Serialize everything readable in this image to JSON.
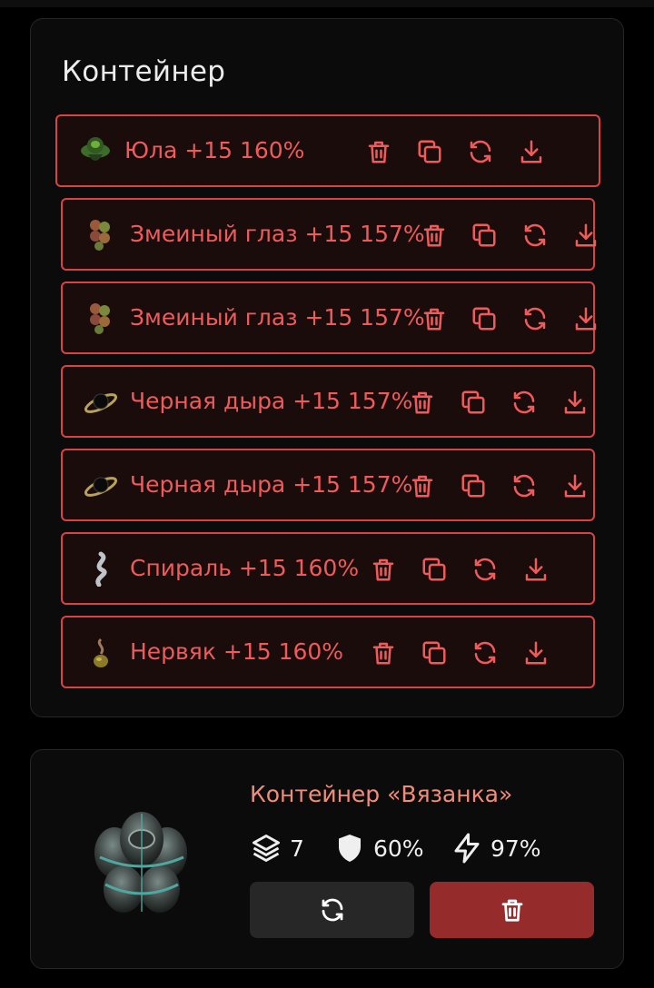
{
  "panel": {
    "title": "Контейнер"
  },
  "items": [
    {
      "icon": "spinning-top-artifact-icon",
      "label": "Юла +15 160%"
    },
    {
      "icon": "snake-eye-artifact-icon",
      "label": "Змеиный глаз +15 157%"
    },
    {
      "icon": "snake-eye-artifact-icon",
      "label": "Змеиный глаз +15 157%"
    },
    {
      "icon": "black-hole-artifact-icon",
      "label": "Черная дыра +15 157%"
    },
    {
      "icon": "black-hole-artifact-icon",
      "label": "Черная дыра +15 157%"
    },
    {
      "icon": "spiral-artifact-icon",
      "label": "Спираль +15 160%"
    },
    {
      "icon": "nerve-artifact-icon",
      "label": "Нервяк +15 160%"
    }
  ],
  "item_actions": [
    "trash-icon",
    "copy-icon",
    "refresh-icon",
    "download-icon"
  ],
  "container_card": {
    "title": "Контейнер «Вязанка»",
    "image_icon": "container-vyazanka-image",
    "slots": "7",
    "protection": "60%",
    "efficiency": "97%",
    "slots_icon": "layers-icon",
    "protection_icon": "shield-icon",
    "efficiency_icon": "lightning-icon",
    "refresh_button_icon": "refresh-icon",
    "delete_button_icon": "trash-icon"
  },
  "colors": {
    "accent": "#ef5a5a",
    "row_border": "#d94343",
    "row_bg": "#1b0c0c",
    "card_title": "#f08d7a",
    "delete_button": "#962b2b",
    "refresh_button": "#272727"
  }
}
